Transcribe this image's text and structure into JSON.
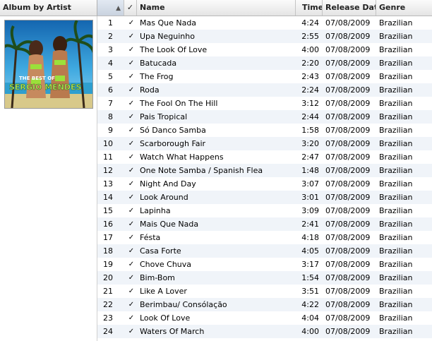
{
  "header": {
    "album_col": "Album by Artist",
    "sort_indicator": "▲",
    "check_col": "✓",
    "name_col": "Name",
    "time_col": "Time",
    "release_col": "Release Date",
    "genre_col": "Genre"
  },
  "album": {
    "cover_line1": "THE BEST OF",
    "cover_line2": "SERGIO MENDES",
    "colors": {
      "sky": "#1f7fc4",
      "sea": "#2fa6d6",
      "sand": "#d8c98a",
      "text": "#b7e85a"
    }
  },
  "tracks": [
    {
      "num": "1",
      "name": "Mas Que Nada",
      "time": "4:24",
      "release": "07/08/2009",
      "genre": "Brazilian"
    },
    {
      "num": "2",
      "name": "Upa Neguinho",
      "time": "2:55",
      "release": "07/08/2009",
      "genre": "Brazilian"
    },
    {
      "num": "3",
      "name": "The Look Of Love",
      "time": "4:00",
      "release": "07/08/2009",
      "genre": "Brazilian"
    },
    {
      "num": "4",
      "name": "Batucada",
      "time": "2:20",
      "release": "07/08/2009",
      "genre": "Brazilian"
    },
    {
      "num": "5",
      "name": "The Frog",
      "time": "2:43",
      "release": "07/08/2009",
      "genre": "Brazilian"
    },
    {
      "num": "6",
      "name": "Roda",
      "time": "2:24",
      "release": "07/08/2009",
      "genre": "Brazilian"
    },
    {
      "num": "7",
      "name": "The Fool On The Hill",
      "time": "3:12",
      "release": "07/08/2009",
      "genre": "Brazilian"
    },
    {
      "num": "8",
      "name": "Pais Tropical",
      "time": "2:44",
      "release": "07/08/2009",
      "genre": "Brazilian"
    },
    {
      "num": "9",
      "name": "Só Danco Samba",
      "time": "1:58",
      "release": "07/08/2009",
      "genre": "Brazilian"
    },
    {
      "num": "10",
      "name": "Scarborough Fair",
      "time": "3:20",
      "release": "07/08/2009",
      "genre": "Brazilian"
    },
    {
      "num": "11",
      "name": "Watch What Happens",
      "time": "2:47",
      "release": "07/08/2009",
      "genre": "Brazilian"
    },
    {
      "num": "12",
      "name": "One Note Samba / Spanish Flea",
      "time": "1:48",
      "release": "07/08/2009",
      "genre": "Brazilian"
    },
    {
      "num": "13",
      "name": "Night And Day",
      "time": "3:07",
      "release": "07/08/2009",
      "genre": "Brazilian"
    },
    {
      "num": "14",
      "name": "Look Around",
      "time": "3:01",
      "release": "07/08/2009",
      "genre": "Brazilian"
    },
    {
      "num": "15",
      "name": "Lapinha",
      "time": "3:09",
      "release": "07/08/2009",
      "genre": "Brazilian"
    },
    {
      "num": "16",
      "name": "Mais Que Nada",
      "time": "2:41",
      "release": "07/08/2009",
      "genre": "Brazilian"
    },
    {
      "num": "17",
      "name": "Fésta",
      "time": "4:18",
      "release": "07/08/2009",
      "genre": "Brazilian"
    },
    {
      "num": "18",
      "name": "Casa Forte",
      "time": "4:05",
      "release": "07/08/2009",
      "genre": "Brazilian"
    },
    {
      "num": "19",
      "name": "Chove Chuva",
      "time": "3:17",
      "release": "07/08/2009",
      "genre": "Brazilian"
    },
    {
      "num": "20",
      "name": "Bim-Bom",
      "time": "1:54",
      "release": "07/08/2009",
      "genre": "Brazilian"
    },
    {
      "num": "21",
      "name": "Like A Lover",
      "time": "3:51",
      "release": "07/08/2009",
      "genre": "Brazilian"
    },
    {
      "num": "22",
      "name": "Berimbau/ Consólação",
      "time": "4:22",
      "release": "07/08/2009",
      "genre": "Brazilian"
    },
    {
      "num": "23",
      "name": "Look Of Love",
      "time": "4:04",
      "release": "07/08/2009",
      "genre": "Brazilian"
    },
    {
      "num": "24",
      "name": "Waters Of March",
      "time": "4:00",
      "release": "07/08/2009",
      "genre": "Brazilian"
    }
  ]
}
